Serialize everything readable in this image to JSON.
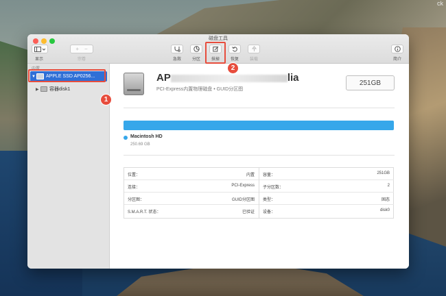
{
  "desktop": {
    "corner_text": "ck"
  },
  "window": {
    "title": "磁盘工具"
  },
  "toolbar": {
    "view_label": "显示",
    "volume_label": "宗卷",
    "volume_add": "+",
    "volume_remove": "−",
    "first_aid_label": "急救",
    "partition_label": "分区",
    "erase_label": "抹掉",
    "restore_label": "恢复",
    "mount_label": "装载",
    "info_label": "简介"
  },
  "annotations": {
    "step1": "1",
    "step2": "2"
  },
  "sidebar": {
    "section_label": "内置",
    "selected_disk": "APPLE SSD AP0256...",
    "child_volume": "容器disk1"
  },
  "disk": {
    "name_prefix": "AP",
    "name_suffix": "lia",
    "description": "PCI-Express内置物理磁盘 • GUID分区图",
    "capacity": "251GB",
    "usage_fraction": 1.0,
    "volume_name": "Macintosh HD",
    "volume_size": "250.69 GB"
  },
  "info": {
    "left": [
      {
        "k": "位置：",
        "v": "内置"
      },
      {
        "k": "连接：",
        "v": "PCI-Express"
      },
      {
        "k": "分区图：",
        "v": "GUID分区图"
      },
      {
        "k": "S.M.A.R.T. 状态：",
        "v": "已验证"
      }
    ],
    "right": [
      {
        "k": "容量：",
        "v": "251GB"
      },
      {
        "k": "子分区数：",
        "v": "2"
      },
      {
        "k": "类型：",
        "v": "固态"
      },
      {
        "k": "设备：",
        "v": "disk0"
      }
    ]
  },
  "colors": {
    "accent": "#36a7ea",
    "selection": "#2f6fd6",
    "annotation": "#e74c3c"
  }
}
